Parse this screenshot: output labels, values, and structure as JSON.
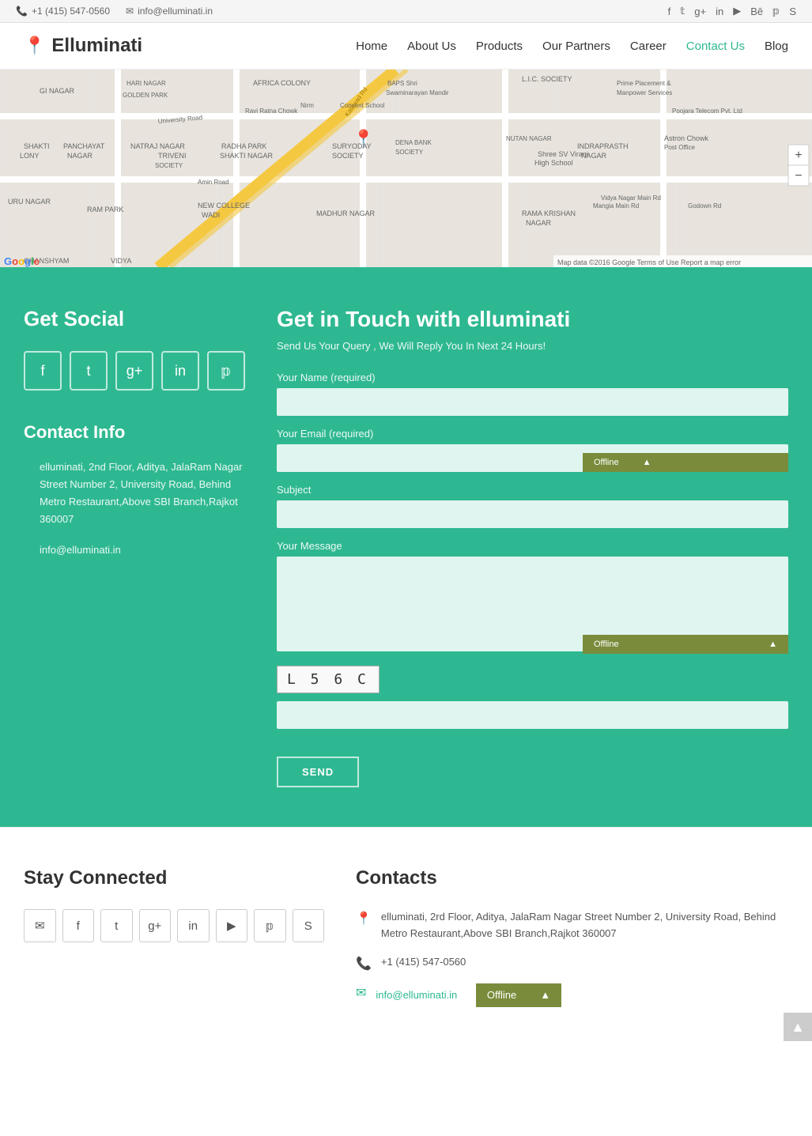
{
  "topBar": {
    "phone": "+1 (415) 547-0560",
    "email": "info@elluminati.in"
  },
  "header": {
    "logo": "Elluminati",
    "nav": [
      {
        "label": "Home",
        "href": "#",
        "active": false
      },
      {
        "label": "About Us",
        "href": "#",
        "active": false
      },
      {
        "label": "Products",
        "href": "#",
        "active": false
      },
      {
        "label": "Our Partners",
        "href": "#",
        "active": false
      },
      {
        "label": "Career",
        "href": "#",
        "active": false
      },
      {
        "label": "Contact Us",
        "href": "#",
        "active": true
      },
      {
        "label": "Blog",
        "href": "#",
        "active": false
      }
    ]
  },
  "socialIcons": [
    "f",
    "t",
    "g+",
    "in",
    "p"
  ],
  "getSocial": {
    "title": "Get Social"
  },
  "contactInfo": {
    "title": "Contact Info",
    "address": "elluminati, 2nd Floor, Aditya, JalaRam Nagar Street Number 2, University Road, Behind Metro Restaurant,Above SBI Branch,Rajkot 360007",
    "email": "info@elluminati.in"
  },
  "getInTouch": {
    "title": "Get in Touch with elluminati",
    "subtitle": "Send Us Your Query , We Will Reply You In Next 24 Hours!",
    "nameLabelText": "Your Name (required)",
    "emailLabelText": "Your Email (required)",
    "subjectLabelText": "Subject",
    "messageLabelText": "Your Message",
    "captchaValue": "L 5 6 C",
    "sendButton": "SEND",
    "offlineLabel": "Offline"
  },
  "footer": {
    "stayConnected": {
      "title": "Stay Connected"
    },
    "contacts": {
      "title": "Contacts",
      "address": "elluminati, 2rd Floor, Aditya, JalaRam Nagar Street Number 2, University Road, Behind Metro Restaurant,Above SBI Branch,Rajkot 360007",
      "phone": "+1 (415) 547-0560",
      "email": "info@elluminati.in"
    }
  },
  "map": {
    "footer": "Map data ©2016 Google  Terms of Use  Report a map error",
    "zoomIn": "+",
    "zoomOut": "−"
  }
}
